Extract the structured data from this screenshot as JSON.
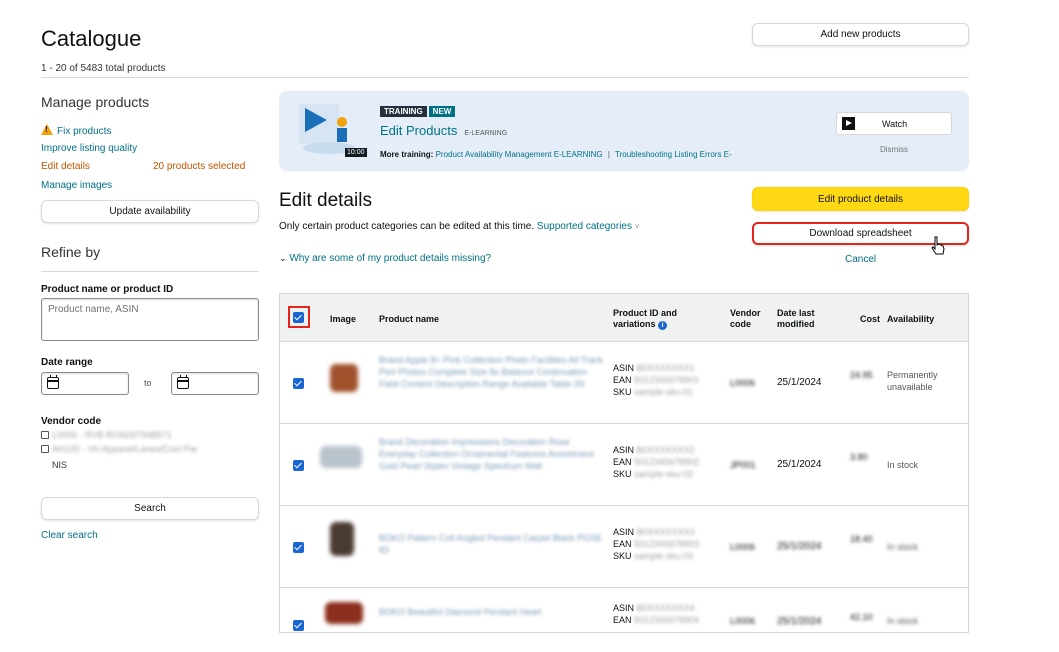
{
  "header": {
    "title": "Catalogue",
    "count": "1 - 20 of 5483 total products",
    "add_button": "Add new products"
  },
  "sidebar": {
    "manage_title": "Manage products",
    "fix_products": "Fix products",
    "improve_quality": "Improve listing quality",
    "edit_details": "Edit details",
    "selected_count": "20 products selected",
    "manage_images": "Manage images",
    "update_availability": "Update availability",
    "refine_title": "Refine by",
    "product_label": "Product name or product ID",
    "product_placeholder": "Product name, ASIN",
    "date_label": "Date range",
    "date_to": "to",
    "vendor_label": "Vendor code",
    "vendor_items": [
      "L0006 - RVB ROAD07948571",
      "AH120 - VH Apparel/Lanes/Cool Par"
    ],
    "vendor_extra": "NIS",
    "search_button": "Search",
    "clear_search": "Clear search"
  },
  "banner": {
    "badge_training": "TRAINING",
    "badge_new": "NEW",
    "title": "Edit Products",
    "subtitle": "E-LEARNING",
    "duration": "10:00",
    "more_label": "More training:",
    "link1": "Product Availability Management E-LEARNING",
    "separator": "|",
    "link2": "Troubleshooting Listing Errors E-",
    "watch": "Watch",
    "dismiss": "Dismiss"
  },
  "edit": {
    "heading": "Edit details",
    "desc": "Only certain product categories can be edited at this time.",
    "supported": "Supported categories",
    "missing": "Why are some of my product details missing?",
    "edit_button": "Edit product details",
    "download_button": "Download spreadsheet",
    "cancel": "Cancel"
  },
  "table": {
    "headers": {
      "image": "Image",
      "name": "Product name",
      "id1": "Product ID and",
      "id2": "variations",
      "vendor1": "Vendor",
      "vendor2": "code",
      "date1": "Date last",
      "date2": "modified",
      "cost": "Cost",
      "availability": "Availability"
    },
    "id_labels": [
      "ASIN",
      "EAN",
      "SKU"
    ],
    "rows": [
      {
        "name": "Brand Apple 8+ Pink Collection Photo Facilities All Track Pert Photos Complete Size 8x Balance Continuation Field Content Description Range Available Table 3S",
        "asin": "B0XXXXXXX1",
        "ean": "5012345678901",
        "sku": "sample-sku-01",
        "vendor": "L0006",
        "date": "25/1/2024",
        "cost": "24.95",
        "availability": "Permanently unavailable",
        "img_color": "#a0522d"
      },
      {
        "name": "Brand Decoration Impressions Decoration Rose Everyday Collection Ornamental Features Assortment Gold Pearl Styles Vintage Spectrum Wall",
        "asin": "B0XXXXXXX2",
        "ean": "5012345678902",
        "sku": "sample-sku-02",
        "vendor": "JP001",
        "date": "25/1/2024",
        "cost": "3.80",
        "availability": "In stock",
        "img_color": "#b9c3cc"
      },
      {
        "name": "BOKO Pattern Coil Angled Pendant Carpet Black PGSE 83",
        "asin": "B0XXXXXXX3",
        "ean": "5012345678903",
        "sku": "sample-sku-03",
        "vendor": "L0006",
        "date": "25/1/2024",
        "cost": "18.40",
        "availability": "In stock",
        "img_color": "#4a3b32"
      },
      {
        "name": "BOKO Beautiful Diamond Pendant Heart",
        "asin": "B0XXXXXXX4",
        "ean": "5012345678904",
        "sku": "sample-sku-04",
        "vendor": "L0006",
        "date": "25/1/2024",
        "cost": "42.10",
        "availability": "In stock",
        "img_color": "#8b2e1e"
      }
    ]
  }
}
